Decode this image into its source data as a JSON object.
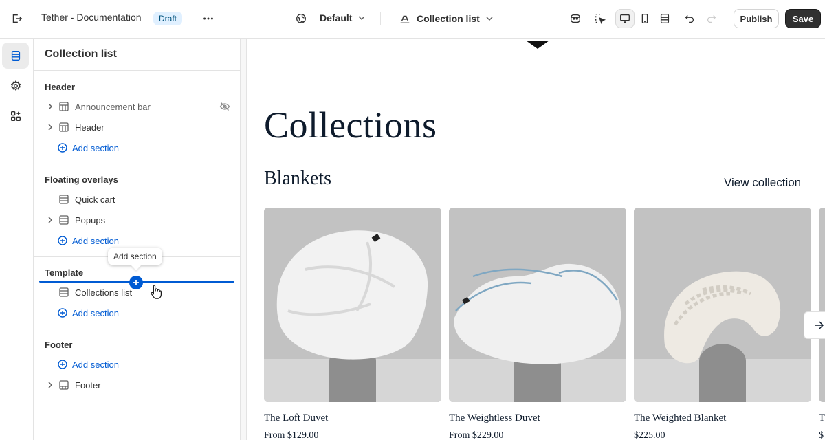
{
  "topbar": {
    "title": "Tether - Documentation",
    "status_badge": "Draft",
    "theme_dropdown": "Default",
    "template_dropdown": "Collection list",
    "publish_label": "Publish",
    "save_label": "Save",
    "icons": [
      "exit-icon",
      "more-icon",
      "globe-icon",
      "template-icon",
      "ai-icon",
      "inspector-icon",
      "desktop-icon",
      "mobile-icon",
      "fullwidth-icon",
      "undo-icon",
      "redo-icon"
    ]
  },
  "rail": {
    "items": [
      {
        "name": "sections-icon",
        "active": true
      },
      {
        "name": "settings-icon",
        "active": false
      },
      {
        "name": "apps-icon",
        "active": false
      }
    ]
  },
  "sidebar": {
    "title": "Collection list",
    "groups": {
      "header": {
        "label": "Header",
        "items": [
          "Announcement bar",
          "Header"
        ],
        "add_label": "Add section"
      },
      "overlays": {
        "label": "Floating overlays",
        "items": [
          "Quick cart",
          "Popups"
        ],
        "add_label": "Add section"
      },
      "template": {
        "label": "Template",
        "items": [
          "Collections list"
        ],
        "add_label": "Add section"
      },
      "footer": {
        "label": "Footer",
        "items": [
          "Footer"
        ],
        "add_label": "Add section"
      }
    },
    "tooltip": "Add section"
  },
  "preview": {
    "page_heading": "Collections",
    "collection_title": "Blankets",
    "view_collection": "View collection",
    "products": [
      {
        "name": "The Loft Duvet",
        "price": "From $129.00"
      },
      {
        "name": "The Weightless Duvet",
        "price": "From $229.00"
      },
      {
        "name": "The Weighted Blanket",
        "price": "$225.00"
      }
    ],
    "partial_product": {
      "name": "T",
      "price": "$"
    }
  },
  "colors": {
    "accent": "#005bd3",
    "badge_bg": "#e0f0ff",
    "save_bg": "#303030",
    "heading_text": "#0e1b2c"
  }
}
